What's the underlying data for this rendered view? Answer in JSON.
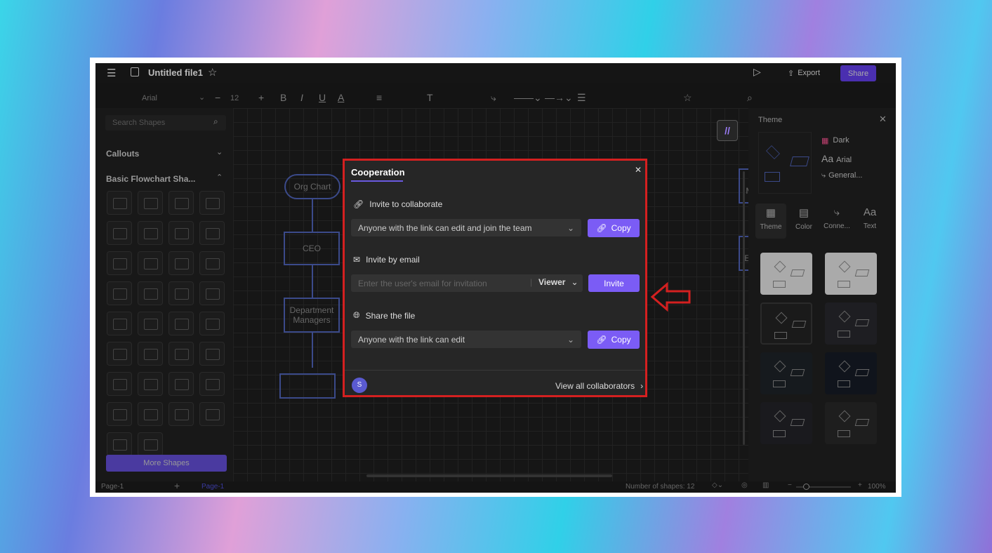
{
  "app": {
    "file_title": "Untitled file1",
    "export_label": "Export",
    "share_label": "Share"
  },
  "toolbar": {
    "font": "Arial",
    "font_size": "12"
  },
  "left_panel": {
    "search_placeholder": "Search Shapes",
    "section1": "Callouts",
    "section2": "Basic Flowchart Sha...",
    "more_shapes": "More Shapes"
  },
  "canvas": {
    "nodes": [
      "Org Chart",
      "CEO",
      "Department Managers",
      "Sales Manager",
      "Sales Employee"
    ]
  },
  "dialog": {
    "title": "Cooperation",
    "invite_collab_label": "Invite to collaborate",
    "collab_select": "Anyone with the link can edit and join the team",
    "copy_label": "Copy",
    "invite_email_label": "Invite by email",
    "email_placeholder": "Enter the user's email for invitation",
    "role": "Viewer",
    "invite_btn": "Invite",
    "share_file_label": "Share the file",
    "share_select": "Anyone with the link can edit",
    "avatar_initial": "S",
    "view_all": "View all collaborators"
  },
  "right_panel": {
    "title": "Theme",
    "theme_name": "Dark",
    "font": "Arial",
    "connector": "General...",
    "tabs": [
      "Theme",
      "Color",
      "Conne...",
      "Text"
    ]
  },
  "bottom_bar": {
    "page_select": "Page-1",
    "page_tab": "Page-1",
    "shape_count": "Number of shapes: 12",
    "zoom": "100%"
  },
  "colors": {
    "accent": "#7b5cf5",
    "highlight_border": "#d42020",
    "arrow": "#d42020"
  }
}
